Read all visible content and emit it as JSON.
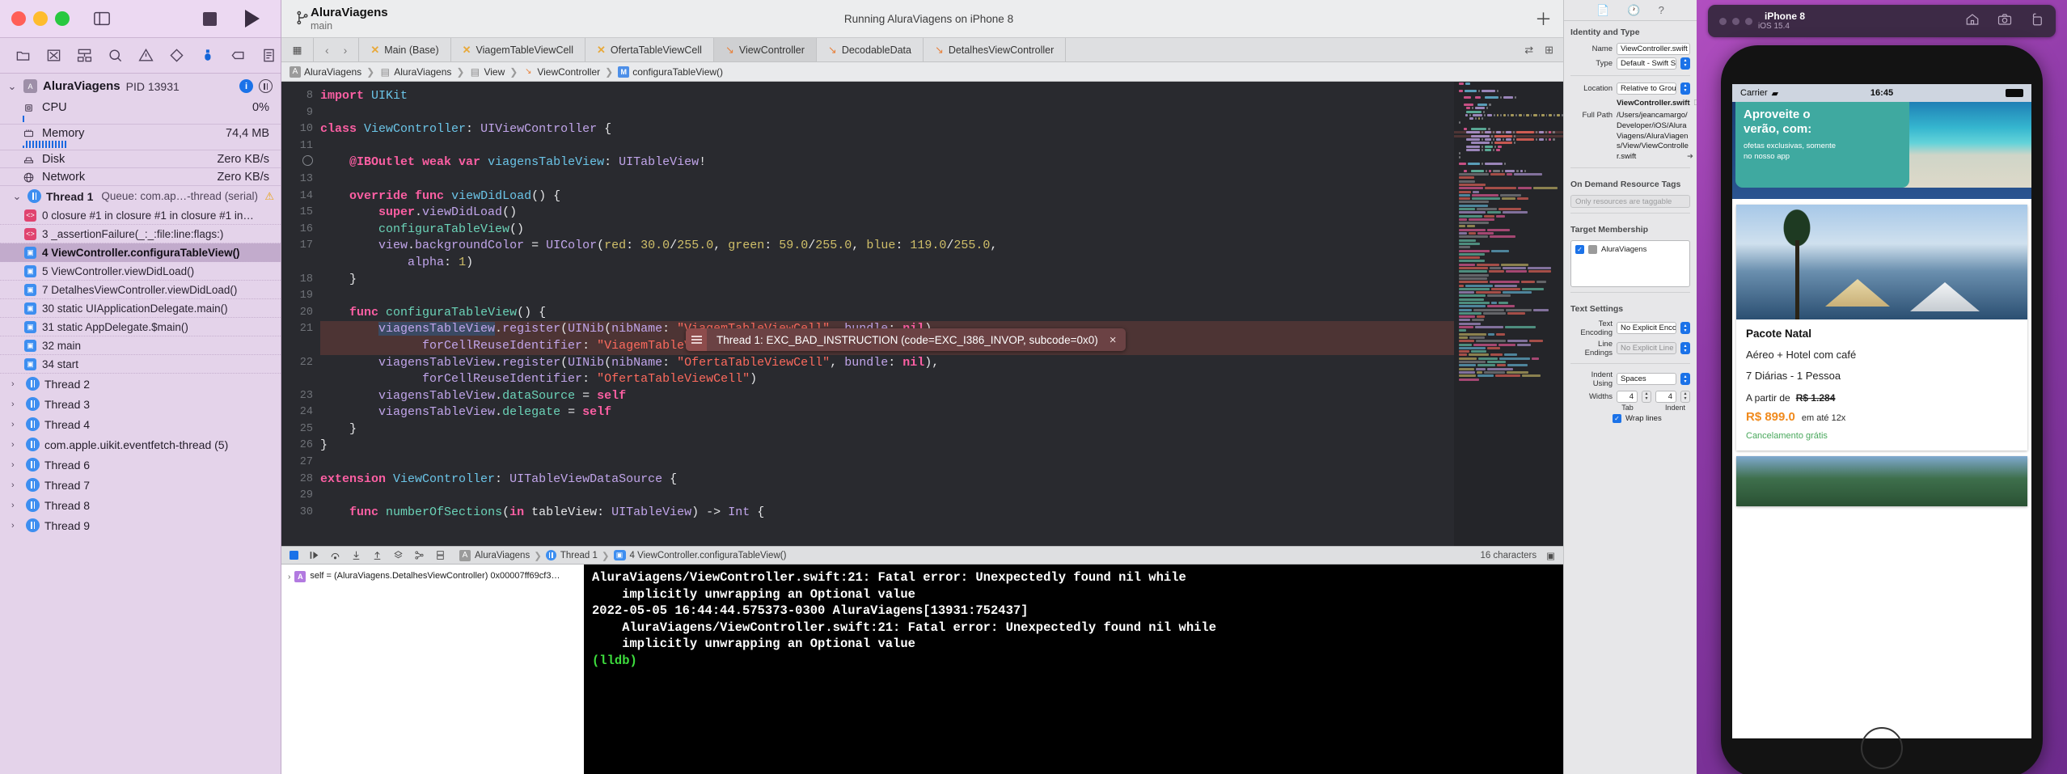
{
  "window": {
    "title": "AluraViagens",
    "subtitle": "main",
    "run_status": "Running AluraViagens on iPhone 8",
    "scheme": "AluraViagens",
    "destination": "iPhone 8"
  },
  "debug_navigator": {
    "process": {
      "name": "AluraViagens",
      "pid_label": "PID 13931"
    },
    "gauges": [
      {
        "name": "CPU",
        "value": "0%",
        "icon": "cpu-icon"
      },
      {
        "name": "Memory",
        "value": "74,4 MB",
        "icon": "memory-icon"
      },
      {
        "name": "Disk",
        "value": "Zero KB/s",
        "icon": "disk-icon"
      },
      {
        "name": "Network",
        "value": "Zero KB/s",
        "icon": "network-icon"
      }
    ],
    "thread1": {
      "name": "Thread 1",
      "queue": "Queue: com.ap…-thread (serial)"
    },
    "frames": [
      {
        "num": "0",
        "label": "0 closure #1 in closure #1 in closure #1 in…",
        "kind": "system",
        "selected": false
      },
      {
        "num": "3",
        "label": "3 _assertionFailure(_:_:file:line:flags:)",
        "kind": "system",
        "selected": false
      },
      {
        "num": "4",
        "label": "4 ViewController.configuraTableView()",
        "kind": "user",
        "selected": true
      },
      {
        "num": "5",
        "label": "5 ViewController.viewDidLoad()",
        "kind": "user",
        "selected": false
      },
      {
        "num": "7",
        "label": "7 DetalhesViewController.viewDidLoad()",
        "kind": "user",
        "selected": false
      },
      {
        "num": "30",
        "label": "30 static UIApplicationDelegate.main()",
        "kind": "user",
        "selected": false
      },
      {
        "num": "31",
        "label": "31 static AppDelegate.$main()",
        "kind": "user",
        "selected": false
      },
      {
        "num": "32",
        "label": "32 main",
        "kind": "user",
        "selected": false
      },
      {
        "num": "34",
        "label": "34 start",
        "kind": "user",
        "selected": false
      }
    ],
    "other_threads": [
      "Thread 2",
      "Thread 3",
      "Thread 4",
      "com.apple.uikit.eventfetch-thread (5)",
      "Thread 6",
      "Thread 7",
      "Thread 8",
      "Thread 9"
    ]
  },
  "editor": {
    "tabs": [
      {
        "label": "Main (Base)",
        "icon": "interface-builder-icon",
        "active": false
      },
      {
        "label": "ViagemTableViewCell",
        "icon": "interface-builder-icon",
        "active": false
      },
      {
        "label": "OfertaTableViewCell",
        "icon": "interface-builder-icon",
        "active": false
      },
      {
        "label": "ViewController",
        "icon": "swift-icon",
        "active": true
      },
      {
        "label": "DecodableData",
        "icon": "swift-icon",
        "active": false
      },
      {
        "label": "DetalhesViewController",
        "icon": "swift-icon",
        "active": false
      }
    ],
    "breadcrumb": [
      {
        "label": "AluraViagens",
        "icon": "app-icon"
      },
      {
        "label": "AluraViagens",
        "icon": "folder-icon"
      },
      {
        "label": "View",
        "icon": "folder-icon"
      },
      {
        "label": "ViewController",
        "icon": "swift-icon"
      },
      {
        "label": "configuraTableView()",
        "icon": "method-icon"
      }
    ],
    "char_count": "16 characters",
    "error_banner": {
      "text": "Thread 1: EXC_BAD_INSTRUCTION (code=EXC_I386_INVOP, subcode=0x0)",
      "close": "×"
    },
    "lines": [
      {
        "n": "8",
        "tokens": [
          {
            "t": "import",
            "c": "kw"
          },
          {
            "t": " UIKit",
            "c": "typ"
          }
        ]
      },
      {
        "n": "9",
        "tokens": []
      },
      {
        "n": "10",
        "tokens": [
          {
            "t": "class ",
            "c": "kw"
          },
          {
            "t": "ViewController",
            "c": "typ"
          },
          {
            "t": ": ",
            "c": "plain"
          },
          {
            "t": "UIViewController",
            "c": "id"
          },
          {
            "t": " {",
            "c": "plain"
          }
        ]
      },
      {
        "n": "11",
        "tokens": []
      },
      {
        "n": "",
        "breakpoint": true,
        "tokens": [
          {
            "t": "    ",
            "c": "plain"
          },
          {
            "t": "@IBOutlet",
            "c": "attr"
          },
          {
            "t": " ",
            "c": "plain"
          },
          {
            "t": "weak var",
            "c": "kw"
          },
          {
            "t": " ",
            "c": "plain"
          },
          {
            "t": "viagensTableView",
            "c": "typ"
          },
          {
            "t": ": ",
            "c": "plain"
          },
          {
            "t": "UITableView",
            "c": "id"
          },
          {
            "t": "!",
            "c": "plain"
          }
        ]
      },
      {
        "n": "13",
        "tokens": []
      },
      {
        "n": "14",
        "tokens": [
          {
            "t": "    ",
            "c": "plain"
          },
          {
            "t": "override func",
            "c": "kw"
          },
          {
            "t": " ",
            "c": "plain"
          },
          {
            "t": "viewDidLoad",
            "c": "typ"
          },
          {
            "t": "() {",
            "c": "plain"
          }
        ]
      },
      {
        "n": "15",
        "tokens": [
          {
            "t": "        ",
            "c": "plain"
          },
          {
            "t": "super",
            "c": "kw"
          },
          {
            "t": ".",
            "c": "plain"
          },
          {
            "t": "viewDidLoad",
            "c": "id"
          },
          {
            "t": "()",
            "c": "plain"
          }
        ]
      },
      {
        "n": "16",
        "tokens": [
          {
            "t": "        ",
            "c": "plain"
          },
          {
            "t": "configuraTableView",
            "c": "fn"
          },
          {
            "t": "()",
            "c": "plain"
          }
        ]
      },
      {
        "n": "17",
        "tokens": [
          {
            "t": "        ",
            "c": "plain"
          },
          {
            "t": "view",
            "c": "id"
          },
          {
            "t": ".",
            "c": "plain"
          },
          {
            "t": "backgroundColor",
            "c": "id"
          },
          {
            "t": " = ",
            "c": "plain"
          },
          {
            "t": "UIColor",
            "c": "id"
          },
          {
            "t": "(",
            "c": "plain"
          },
          {
            "t": "red",
            "c": "num"
          },
          {
            "t": ": ",
            "c": "plain"
          },
          {
            "t": "30.0",
            "c": "num"
          },
          {
            "t": "/",
            "c": "plain"
          },
          {
            "t": "255.0",
            "c": "num"
          },
          {
            "t": ", ",
            "c": "plain"
          },
          {
            "t": "green",
            "c": "num"
          },
          {
            "t": ": ",
            "c": "plain"
          },
          {
            "t": "59.0",
            "c": "num"
          },
          {
            "t": "/",
            "c": "plain"
          },
          {
            "t": "255.0",
            "c": "num"
          },
          {
            "t": ", ",
            "c": "plain"
          },
          {
            "t": "blue",
            "c": "num"
          },
          {
            "t": ": ",
            "c": "plain"
          },
          {
            "t": "119.0",
            "c": "num"
          },
          {
            "t": "/",
            "c": "plain"
          },
          {
            "t": "255.0",
            "c": "num"
          },
          {
            "t": ",",
            "c": "plain"
          }
        ]
      },
      {
        "n": "",
        "tokens": [
          {
            "t": "            ",
            "c": "plain"
          },
          {
            "t": "alpha",
            "c": "id"
          },
          {
            "t": ": ",
            "c": "plain"
          },
          {
            "t": "1",
            "c": "num"
          },
          {
            "t": ")",
            "c": "plain"
          }
        ]
      },
      {
        "n": "18",
        "tokens": [
          {
            "t": "    }",
            "c": "plain"
          }
        ]
      },
      {
        "n": "19",
        "tokens": []
      },
      {
        "n": "20",
        "tokens": [
          {
            "t": "    ",
            "c": "plain"
          },
          {
            "t": "func",
            "c": "kw"
          },
          {
            "t": " ",
            "c": "plain"
          },
          {
            "t": "configuraTableView",
            "c": "fn"
          },
          {
            "t": "() {",
            "c": "plain"
          }
        ]
      },
      {
        "n": "21",
        "highlight": true,
        "tokens": [
          {
            "t": "        ",
            "c": "plain"
          },
          {
            "t": "viagensTableView",
            "c": "sel-tok id"
          },
          {
            "t": ".",
            "c": "plain"
          },
          {
            "t": "register",
            "c": "id"
          },
          {
            "t": "(",
            "c": "plain"
          },
          {
            "t": "UINib",
            "c": "id"
          },
          {
            "t": "(",
            "c": "plain"
          },
          {
            "t": "nibName",
            "c": "id"
          },
          {
            "t": ": ",
            "c": "plain"
          },
          {
            "t": "\"ViagemTableViewCell\"",
            "c": "str"
          },
          {
            "t": ", ",
            "c": "plain"
          },
          {
            "t": "bundle",
            "c": "id"
          },
          {
            "t": ": ",
            "c": "plain"
          },
          {
            "t": "nil",
            "c": "kw"
          },
          {
            "t": "),",
            "c": "plain"
          }
        ]
      },
      {
        "n": "",
        "highlight": true,
        "tokens": [
          {
            "t": "              ",
            "c": "plain"
          },
          {
            "t": "forCellReuseIdentifier",
            "c": "id"
          },
          {
            "t": ": ",
            "c": "plain"
          },
          {
            "t": "\"ViagemTableViewCell\"",
            "c": "str"
          },
          {
            "t": ")",
            "c": "plain"
          }
        ]
      },
      {
        "n": "22",
        "tokens": [
          {
            "t": "        ",
            "c": "plain"
          },
          {
            "t": "viagensTableView",
            "c": "id"
          },
          {
            "t": ".",
            "c": "plain"
          },
          {
            "t": "register",
            "c": "id"
          },
          {
            "t": "(",
            "c": "plain"
          },
          {
            "t": "UINib",
            "c": "id"
          },
          {
            "t": "(",
            "c": "plain"
          },
          {
            "t": "nibName",
            "c": "id"
          },
          {
            "t": ": ",
            "c": "plain"
          },
          {
            "t": "\"OfertaTableViewCell\"",
            "c": "str"
          },
          {
            "t": ", ",
            "c": "plain"
          },
          {
            "t": "bundle",
            "c": "id"
          },
          {
            "t": ": ",
            "c": "plain"
          },
          {
            "t": "nil",
            "c": "kw"
          },
          {
            "t": "),",
            "c": "plain"
          }
        ]
      },
      {
        "n": "",
        "tokens": [
          {
            "t": "              ",
            "c": "plain"
          },
          {
            "t": "forCellReuseIdentifier",
            "c": "id"
          },
          {
            "t": ": ",
            "c": "plain"
          },
          {
            "t": "\"OfertaTableViewCell\"",
            "c": "str"
          },
          {
            "t": ")",
            "c": "plain"
          }
        ]
      },
      {
        "n": "23",
        "tokens": [
          {
            "t": "        ",
            "c": "plain"
          },
          {
            "t": "viagensTableView",
            "c": "id"
          },
          {
            "t": ".",
            "c": "plain"
          },
          {
            "t": "dataSource",
            "c": "fn"
          },
          {
            "t": " = ",
            "c": "plain"
          },
          {
            "t": "self",
            "c": "kw"
          }
        ]
      },
      {
        "n": "24",
        "tokens": [
          {
            "t": "        ",
            "c": "plain"
          },
          {
            "t": "viagensTableView",
            "c": "id"
          },
          {
            "t": ".",
            "c": "plain"
          },
          {
            "t": "delegate",
            "c": "fn"
          },
          {
            "t": " = ",
            "c": "plain"
          },
          {
            "t": "self",
            "c": "kw"
          }
        ]
      },
      {
        "n": "25",
        "tokens": [
          {
            "t": "    }",
            "c": "plain"
          }
        ]
      },
      {
        "n": "26",
        "tokens": [
          {
            "t": "}",
            "c": "plain"
          }
        ]
      },
      {
        "n": "27",
        "tokens": []
      },
      {
        "n": "28",
        "tokens": [
          {
            "t": "extension ",
            "c": "kw"
          },
          {
            "t": "ViewController",
            "c": "typ"
          },
          {
            "t": ": ",
            "c": "plain"
          },
          {
            "t": "UITableViewDataSource",
            "c": "id"
          },
          {
            "t": " {",
            "c": "plain"
          }
        ]
      },
      {
        "n": "29",
        "tokens": []
      },
      {
        "n": "30",
        "tokens": [
          {
            "t": "    ",
            "c": "plain"
          },
          {
            "t": "func",
            "c": "kw"
          },
          {
            "t": " ",
            "c": "plain"
          },
          {
            "t": "numberOfSections",
            "c": "fn"
          },
          {
            "t": "(",
            "c": "plain"
          },
          {
            "t": "in",
            "c": "kw"
          },
          {
            "t": " tableView",
            "c": "plain"
          },
          {
            "t": ": ",
            "c": "plain"
          },
          {
            "t": "UITableView",
            "c": "id"
          },
          {
            "t": ") -> ",
            "c": "plain"
          },
          {
            "t": "Int",
            "c": "id"
          },
          {
            "t": " {",
            "c": "plain"
          }
        ]
      }
    ]
  },
  "debug_bar": {
    "crumbs": [
      "AluraViagens",
      "Thread 1",
      "4 ViewController.configuraTableView()"
    ]
  },
  "variables_view": {
    "entry": "self = (AluraViagens.DetalhesViewController) 0x00007ff69cf3…"
  },
  "console": {
    "lines": [
      {
        "text": "AluraViagens/ViewController.swift:21: Fatal error: Unexpectedly found nil while",
        "color": "white"
      },
      {
        "text": "    implicitly unwrapping an Optional value",
        "color": "white"
      },
      {
        "text": "2022-05-05 16:44:44.575373-0300 AluraViagens[13931:752437]",
        "color": "white"
      },
      {
        "text": "    AluraViagens/ViewController.swift:21: Fatal error: Unexpectedly found nil while",
        "color": "white"
      },
      {
        "text": "    implicitly unwrapping an Optional value",
        "color": "white"
      },
      {
        "text": "(lldb)",
        "color": "green"
      }
    ]
  },
  "inspector": {
    "section_identity": "Identity and Type",
    "name_label": "Name",
    "name_value": "ViewController.swift",
    "type_label": "Type",
    "type_value": "Default - Swift Source",
    "location_label": "Location",
    "location_value": "Relative to Group",
    "location_file": "ViewController.swift",
    "fullpath_label": "Full Path",
    "fullpath_value": "/Users/jeancamargo/Developer/iOS/AluraViagens/AluraViagens/View/ViewController.swift",
    "section_odr": "On Demand Resource Tags",
    "odr_placeholder": "Only resources are taggable",
    "section_target": "Target Membership",
    "target_item": "AluraViagens",
    "section_text": "Text Settings",
    "encoding_label": "Text Encoding",
    "encoding_value": "No Explicit Encoding",
    "lineend_label": "Line Endings",
    "lineend_value": "No Explicit Line Endings",
    "indent_label": "Indent Using",
    "indent_value": "Spaces",
    "widths_label": "Widths",
    "tab_width": "4",
    "indent_width": "4",
    "tab_caption": "Tab",
    "indent_caption": "Indent",
    "wrap_label": "Wrap lines"
  },
  "simulator": {
    "device": "iPhone 8",
    "os": "iOS 15.4",
    "status_carrier": "Carrier",
    "status_time": "16:45",
    "promo_title": "Aproveite o\nverão, com:",
    "promo_sub": "ofetas exclusivas, somente\nno nosso app",
    "card": {
      "title": "Pacote Natal",
      "line1": "Aéreo + Hotel com café",
      "line2": "7 Diárias - 1 Pessoa",
      "from_label": "A partir de",
      "old_price": "R$ 1.284",
      "price": "R$ 899.0",
      "installments": "em até 12x",
      "free_cancel": "Cancelamento grátis"
    }
  }
}
